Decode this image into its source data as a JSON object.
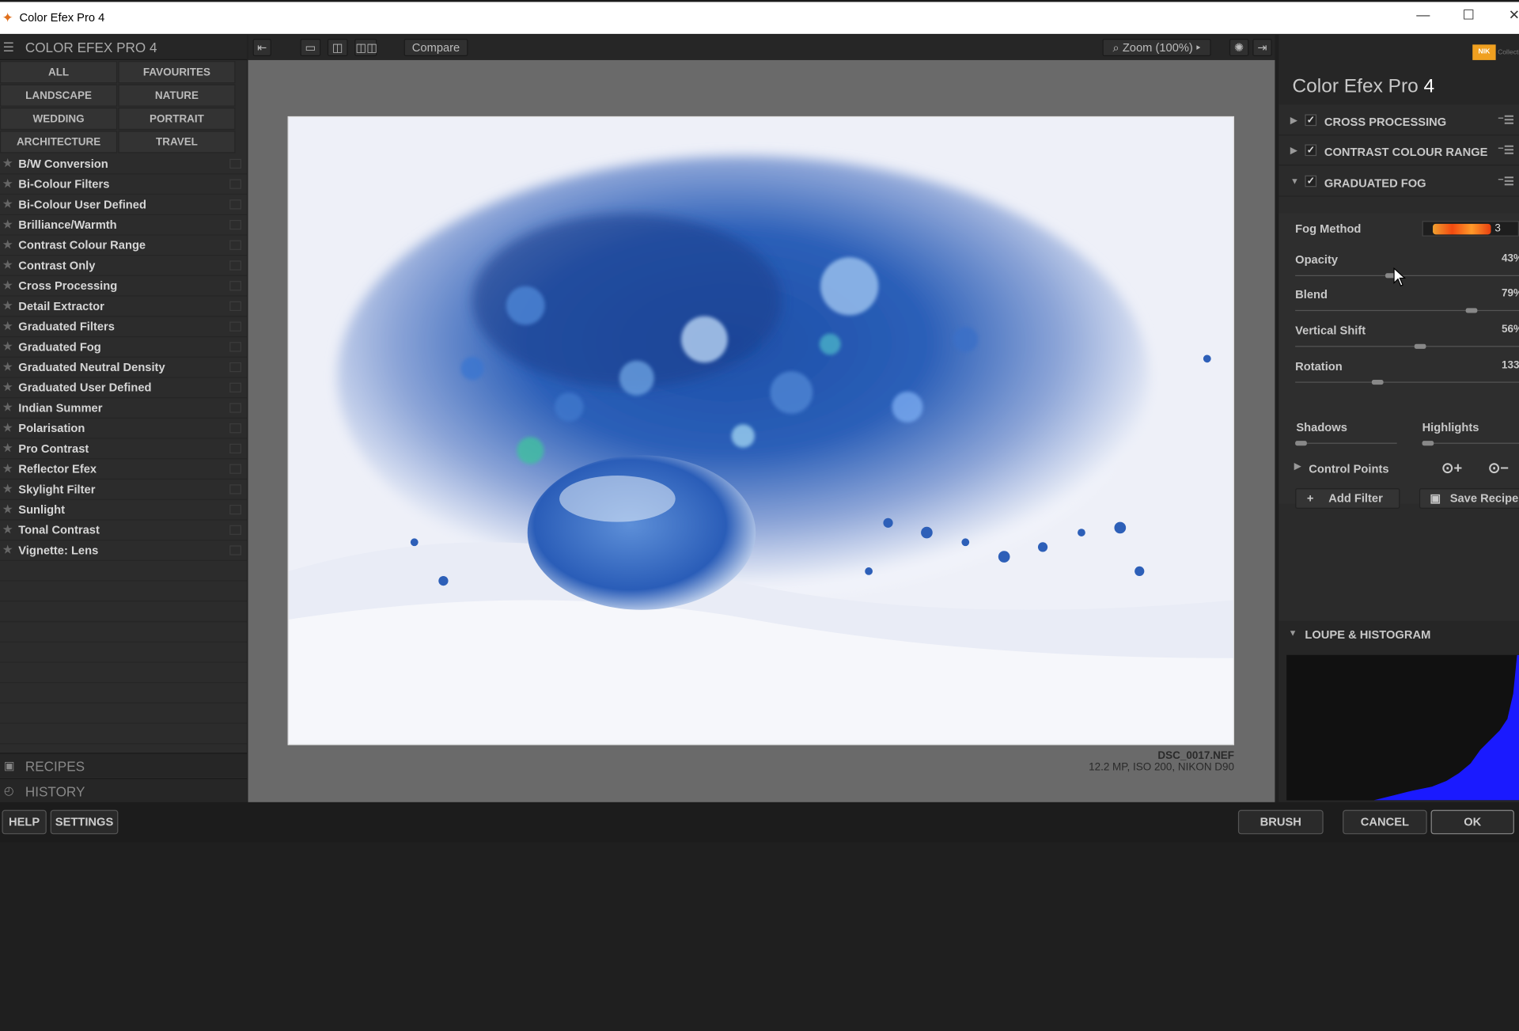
{
  "window": {
    "title": "Color Efex Pro 4",
    "minimize": "—",
    "maximize": "☐",
    "close": "✕"
  },
  "left_panel": {
    "title": "COLOR EFEX PRO 4",
    "categories": [
      "ALL",
      "FAVOURITES",
      "LANDSCAPE",
      "NATURE",
      "WEDDING",
      "PORTRAIT",
      "ARCHITECTURE",
      "TRAVEL"
    ],
    "filters": [
      "B/W Conversion",
      "Bi-Colour Filters",
      "Bi-Colour User Defined",
      "Brilliance/Warmth",
      "Contrast Colour Range",
      "Contrast Only",
      "Cross Processing",
      "Detail Extractor",
      "Graduated Filters",
      "Graduated Fog",
      "Graduated Neutral Density",
      "Graduated User Defined",
      "Indian Summer",
      "Polarisation",
      "Pro Contrast",
      "Reflector Efex",
      "Skylight Filter",
      "Sunlight",
      "Tonal Contrast",
      "Vignette: Lens"
    ],
    "recipes": "RECIPES",
    "history": "HISTORY"
  },
  "toolbar": {
    "compare": "Compare",
    "zoom": "Zoom (100%)"
  },
  "image": {
    "filename": "DSC_0017.NEF",
    "info": "12.2 MP, ISO 200, NIKON D90"
  },
  "right_panel": {
    "title_prefix": "Color Efex Pro",
    "title_version": "4",
    "filter_stack": [
      {
        "name": "CROSS PROCESSING",
        "enabled": true,
        "expanded": false
      },
      {
        "name": "CONTRAST COLOUR RANGE",
        "enabled": true,
        "expanded": false
      },
      {
        "name": "GRADUATED FOG",
        "enabled": true,
        "expanded": true
      }
    ],
    "fog": {
      "method_label": "Fog Method",
      "method_value": "3",
      "opacity_label": "Opacity",
      "opacity_value": "43%",
      "opacity": 0.43,
      "blend_label": "Blend",
      "blend_value": "79%",
      "blend": 0.79,
      "vshift_label": "Vertical Shift",
      "vshift_value": "56%",
      "vshift": 0.56,
      "rotation_label": "Rotation",
      "rotation_value": "133",
      "rotation": 0.37,
      "shadows_label": "Shadows",
      "shadows": 0.0,
      "highlights_label": "Highlights",
      "highlights": 0.0,
      "control_points_label": "Control Points",
      "add_filter": "Add Filter",
      "save_recipe": "Save Recipe"
    },
    "loupe_label": "LOUPE & HISTOGRAM"
  },
  "bottom": {
    "help": "HELP",
    "settings": "SETTINGS",
    "brush": "BRUSH",
    "cancel": "CANCEL",
    "ok": "OK"
  },
  "colors": {
    "accent_orange": "#f0a020",
    "histogram_blue": "#1a1aff"
  }
}
